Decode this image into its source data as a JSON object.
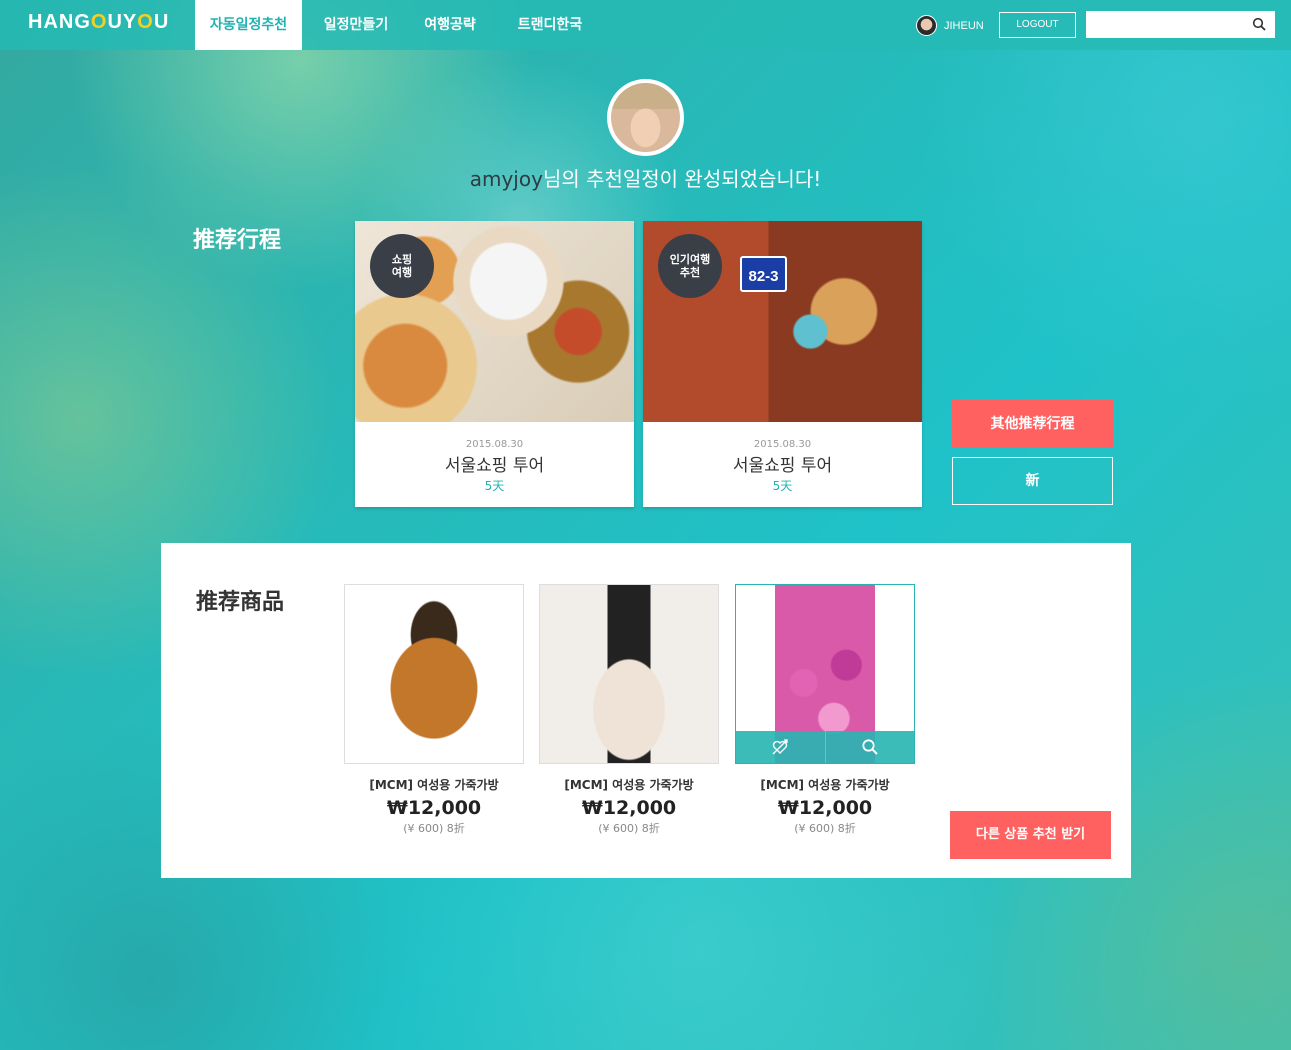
{
  "header": {
    "logo_text": "HANGOUYOU",
    "nav": [
      {
        "label": "자동일정추천",
        "active": true
      },
      {
        "label": "일정만들기"
      },
      {
        "label": "여행공략"
      },
      {
        "label": "트랜디한국"
      }
    ],
    "user": {
      "name": "JIHEUN"
    },
    "logout_label": "LOGOUT",
    "search": {
      "value": "",
      "placeholder": ""
    }
  },
  "profile": {
    "username": "amyjoy",
    "message": "님의 추천일정이 완성되었습니다!"
  },
  "itinerary": {
    "title": "推荐行程",
    "cards": [
      {
        "tag": "쇼핑\n여행",
        "date": "2015.08.30",
        "title": "서울쇼핑 투어",
        "days": "5天"
      },
      {
        "tag": "인기여행\n추천",
        "date": "2015.08.30",
        "title": "서울쇼핑 투어",
        "days": "5天",
        "sign": "82-3"
      }
    ],
    "other_button": "其他推荐行程",
    "new_button": "新"
  },
  "products": {
    "title": "推荐商品",
    "items": [
      {
        "name": "[MCM] 여성용 가죽가방",
        "price": "₩12,000",
        "sub": "(¥ 600) 8折"
      },
      {
        "name": "[MCM] 여성용 가죽가방",
        "price": "₩12,000",
        "sub": "(¥ 600) 8折"
      },
      {
        "name": "[MCM] 여성용 가죽가방",
        "price": "₩12,000",
        "sub": "(¥ 600) 8折"
      }
    ],
    "more_button": "다른 상품 추천 받기"
  },
  "colors": {
    "accent": "#26b5b1",
    "cta": "#ff6060",
    "logo_o": "#f5d020"
  }
}
